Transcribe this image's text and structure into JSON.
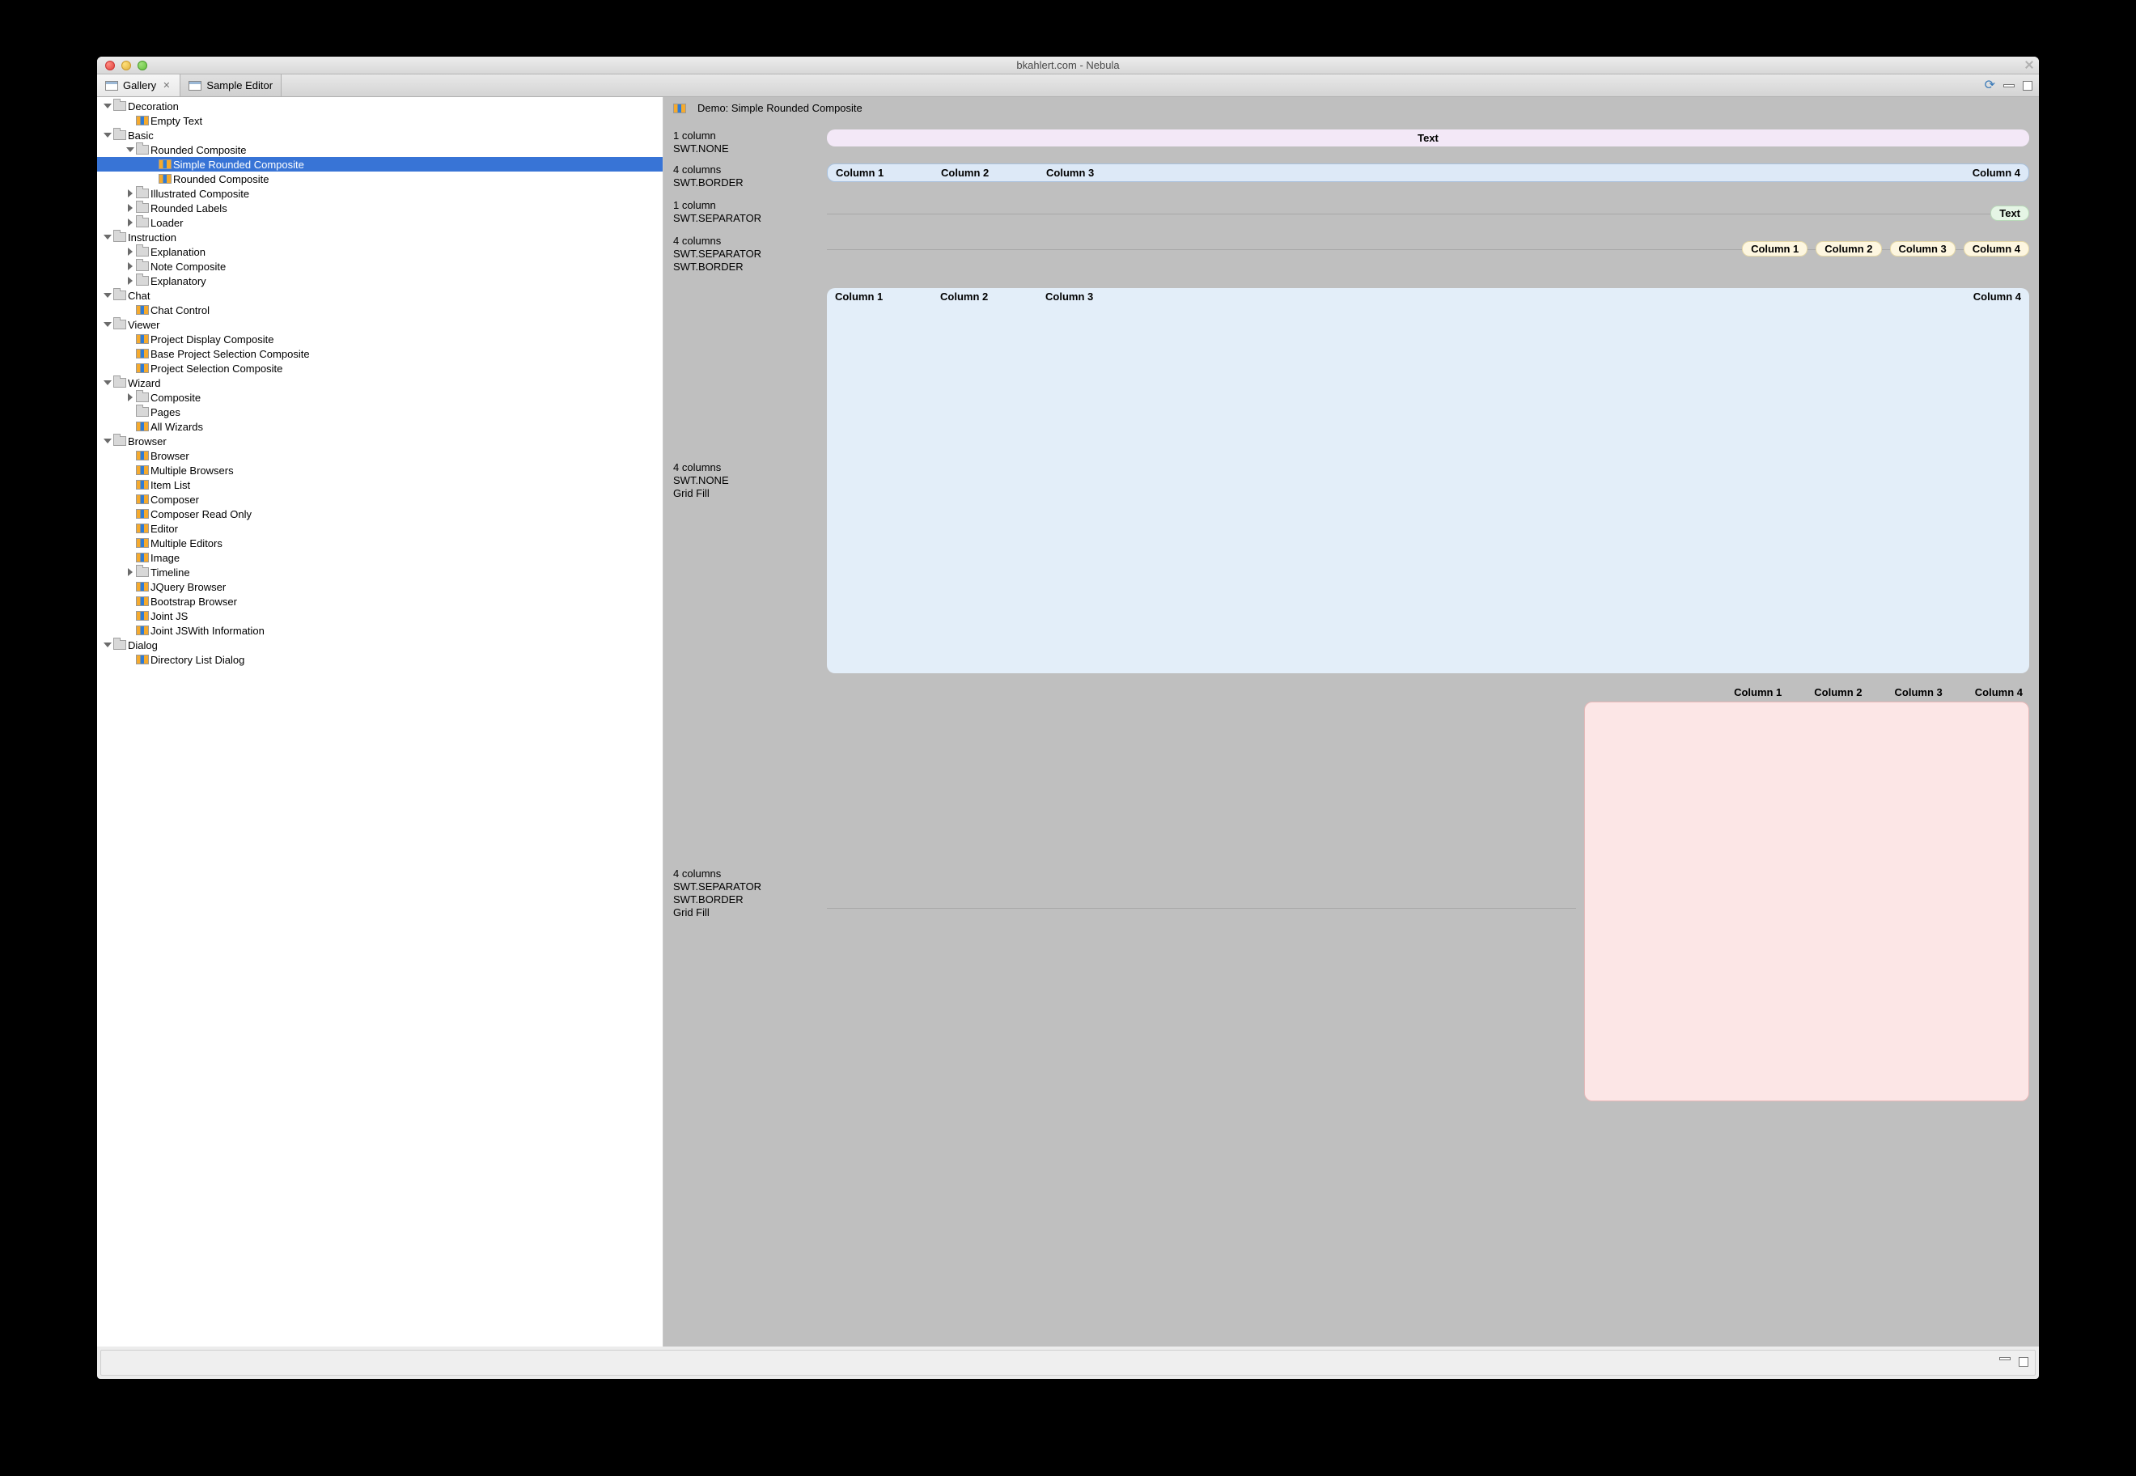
{
  "window": {
    "title": "bkahlert.com - Nebula"
  },
  "tabs": {
    "gallery": "Gallery",
    "sample": "Sample Editor"
  },
  "tree": [
    {
      "d": 0,
      "t": "f",
      "e": "down",
      "l": "Decoration"
    },
    {
      "d": 1,
      "t": "l",
      "l": "Empty Text"
    },
    {
      "d": 0,
      "t": "f",
      "e": "down",
      "l": "Basic"
    },
    {
      "d": 1,
      "t": "f",
      "e": "down",
      "l": "Rounded Composite"
    },
    {
      "d": 2,
      "t": "l",
      "l": "Simple Rounded Composite",
      "sel": true
    },
    {
      "d": 2,
      "t": "l",
      "l": "Rounded Composite"
    },
    {
      "d": 1,
      "t": "f",
      "e": "right",
      "l": "Illustrated Composite"
    },
    {
      "d": 1,
      "t": "f",
      "e": "right",
      "l": "Rounded Labels"
    },
    {
      "d": 1,
      "t": "f",
      "e": "right",
      "l": "Loader"
    },
    {
      "d": 0,
      "t": "f",
      "e": "down",
      "l": "Instruction"
    },
    {
      "d": 1,
      "t": "f",
      "e": "right",
      "l": "Explanation"
    },
    {
      "d": 1,
      "t": "f",
      "e": "right",
      "l": "Note Composite"
    },
    {
      "d": 1,
      "t": "f",
      "e": "right",
      "l": "Explanatory"
    },
    {
      "d": 0,
      "t": "f",
      "e": "down",
      "l": "Chat"
    },
    {
      "d": 1,
      "t": "l",
      "l": "Chat Control"
    },
    {
      "d": 0,
      "t": "f",
      "e": "down",
      "l": "Viewer"
    },
    {
      "d": 1,
      "t": "l",
      "l": "Project Display Composite"
    },
    {
      "d": 1,
      "t": "l",
      "l": "Base Project Selection Composite"
    },
    {
      "d": 1,
      "t": "l",
      "l": "Project Selection Composite"
    },
    {
      "d": 0,
      "t": "f",
      "e": "down",
      "l": "Wizard"
    },
    {
      "d": 1,
      "t": "f",
      "e": "right",
      "l": "Composite"
    },
    {
      "d": 1,
      "t": "f",
      "l": "Pages"
    },
    {
      "d": 1,
      "t": "l",
      "l": "All Wizards"
    },
    {
      "d": 0,
      "t": "f",
      "e": "down",
      "l": "Browser"
    },
    {
      "d": 1,
      "t": "l",
      "l": "Browser"
    },
    {
      "d": 1,
      "t": "l",
      "l": "Multiple Browsers"
    },
    {
      "d": 1,
      "t": "l",
      "l": "Item List"
    },
    {
      "d": 1,
      "t": "l",
      "l": "Composer"
    },
    {
      "d": 1,
      "t": "l",
      "l": "Composer Read Only"
    },
    {
      "d": 1,
      "t": "l",
      "l": "Editor"
    },
    {
      "d": 1,
      "t": "l",
      "l": "Multiple Editors"
    },
    {
      "d": 1,
      "t": "l",
      "l": "Image"
    },
    {
      "d": 1,
      "t": "f",
      "e": "right",
      "l": "Timeline"
    },
    {
      "d": 1,
      "t": "l",
      "l": "JQuery Browser"
    },
    {
      "d": 1,
      "t": "l",
      "l": "Bootstrap Browser"
    },
    {
      "d": 1,
      "t": "l",
      "l": "Joint JS"
    },
    {
      "d": 1,
      "t": "l",
      "l": "Joint JSWith Information"
    },
    {
      "d": 0,
      "t": "f",
      "e": "down",
      "l": "Dialog"
    },
    {
      "d": 1,
      "t": "l",
      "l": "Directory List Dialog"
    }
  ],
  "demo": {
    "title": "Demo: Simple Rounded Composite",
    "labels": {
      "r1a": "1 column",
      "r1b": "SWT.NONE",
      "r2a": "4 columns",
      "r2b": "SWT.BORDER",
      "r3a": "1 column",
      "r3b": "SWT.SEPARATOR",
      "r4a": "4 columns",
      "r4b": "SWT.SEPARATOR",
      "r4c": "SWT.BORDER",
      "r5a": "4 columns",
      "r5b": "SWT.NONE",
      "r5c": "Grid Fill",
      "r6a": "4 columns",
      "r6b": "SWT.SEPARATOR",
      "r6c": "SWT.BORDER",
      "r6d": "Grid Fill"
    },
    "text": "Text",
    "cols": {
      "c1": "Column 1",
      "c2": "Column 2",
      "c3": "Column 3",
      "c4": "Column 4"
    }
  }
}
